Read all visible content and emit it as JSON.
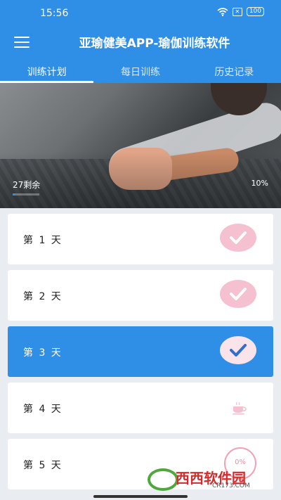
{
  "status_bar": {
    "time": "15:56",
    "battery": "100",
    "sim_icon": "sim-off-icon",
    "wifi_icon": "wifi-icon"
  },
  "header": {
    "title": "亚瑜健美APP-瑜伽训练软件",
    "menu_icon": "hamburger-menu-icon"
  },
  "tabs": [
    {
      "label": "训练计划",
      "active": true
    },
    {
      "label": "每日训练",
      "active": false
    },
    {
      "label": "历史记录",
      "active": false
    }
  ],
  "banner": {
    "remaining": "27剩余",
    "percent": "10%",
    "progress": 0.1
  },
  "days": [
    {
      "label": "第 1 天",
      "state": "done",
      "icon": "checkmark-icon"
    },
    {
      "label": "第 2 天",
      "state": "done",
      "icon": "checkmark-icon"
    },
    {
      "label": "第 3 天",
      "state": "current",
      "icon": "checkmark-icon"
    },
    {
      "label": "第 4 天",
      "state": "rest",
      "icon": "coffee-cup-icon"
    },
    {
      "label": "第 5 天",
      "state": "pending",
      "icon": "progress-ring-icon",
      "progress_label": "0%"
    }
  ],
  "watermark": {
    "text": "西西软件园",
    "url": "CR173.COM"
  },
  "colors": {
    "primary": "#2f8ee6",
    "check_bg": "#f5c1d0",
    "background": "#e9edf1"
  }
}
